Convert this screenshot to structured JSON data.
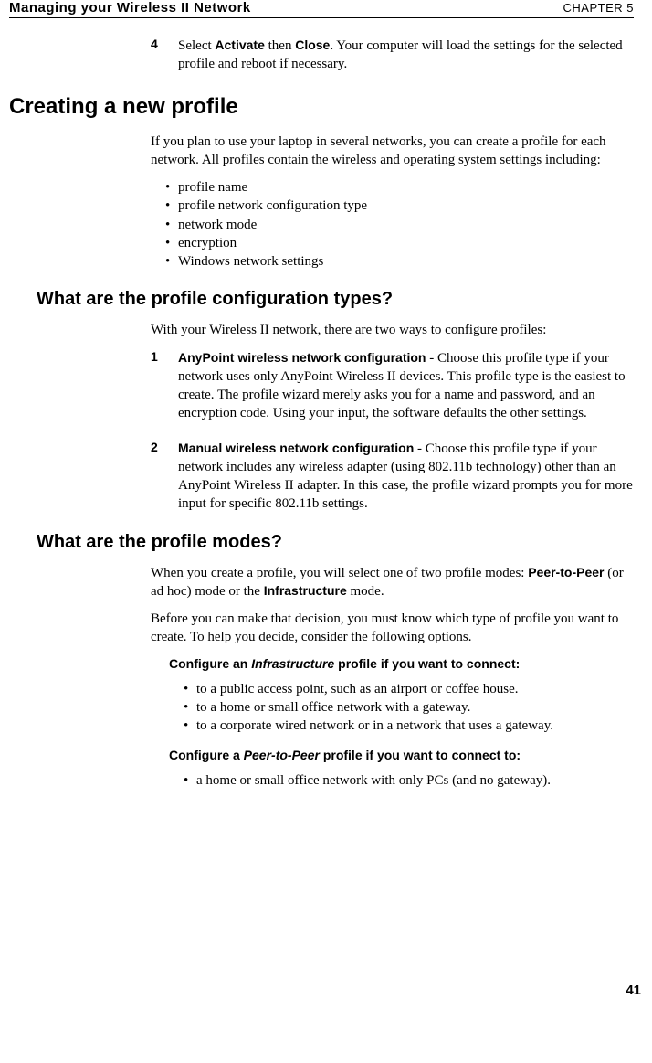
{
  "header": {
    "left": "Managing your Wireless II Network",
    "right": "CHAPTER 5"
  },
  "step4": {
    "num": "4",
    "pre": "Select ",
    "b1": "Activate",
    "mid": " then ",
    "b2": "Close",
    "post": ". Your computer will load the settings for the selected profile and reboot if necessary."
  },
  "h1": "Creating a new profile",
  "intro": "If you plan to use your laptop in several networks, you can create a profile for each network. All profiles contain the wireless and operating system settings including:",
  "bullets_main": [
    "profile name",
    "profile network configuration type",
    "network mode",
    "encryption",
    "Windows network settings"
  ],
  "h2a": "What are the profile configuration types?",
  "h2a_intro": "With your Wireless II network, there are two ways to configure profiles:",
  "cfg1": {
    "num": "1",
    "bold": "AnyPoint wireless network configuration",
    "rest": " - Choose this profile type if your network uses only AnyPoint Wireless II devices. This profile type is the easiest to create. The profile wizard merely asks you for a name and password, and an encryption code. Using your input, the software defaults the other settings."
  },
  "cfg2": {
    "num": "2",
    "bold": "Manual wireless network configuration",
    "rest": " - Choose this profile type if your network includes any wireless adapter (using 802.11b technology) other than an AnyPoint Wireless II adapter. In this case, the profile wizard prompts you for more input for specific 802.11b settings."
  },
  "h2b": "What are the profile modes?",
  "modes_p1": {
    "pre": "When you create a profile, you will select one of two profile modes: ",
    "b1": "Peer-to-Peer",
    "mid": " (or ad hoc) mode or the ",
    "b2": "Infrastructure",
    "post": " mode."
  },
  "modes_p2": "Before you can make that decision, you must know which type of profile you want to create. To help you decide, consider the following options.",
  "infra_head": {
    "pre": "Configure an ",
    "italic": "Infrastructure",
    "post": " profile if you want to connect:"
  },
  "infra_bullets": [
    "to a public access point, such as an airport or coffee house.",
    "to a home or small office network with a gateway.",
    "to a corporate wired network or in a network that uses a gateway."
  ],
  "p2p_head": {
    "pre": "Configure a ",
    "italic": "Peer-to-Peer",
    "post": " profile if you want to connect to:"
  },
  "p2p_bullets": [
    "a home or small office network with only PCs (and no gateway)."
  ],
  "page_num": "41"
}
